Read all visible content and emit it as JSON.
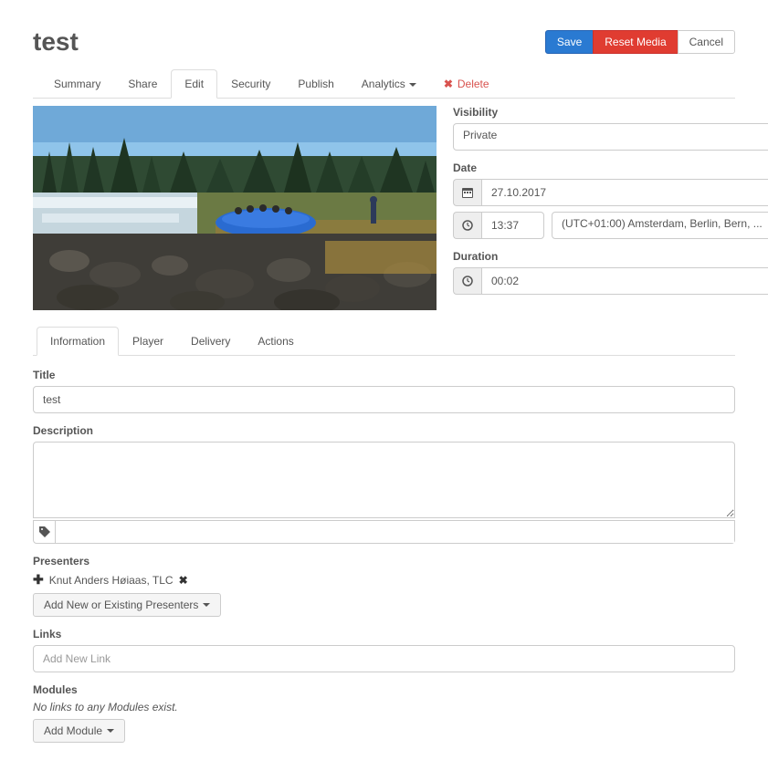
{
  "header": {
    "title": "test",
    "buttons": {
      "save": "Save",
      "reset": "Reset Media",
      "cancel": "Cancel"
    }
  },
  "nav_tabs": {
    "summary": "Summary",
    "share": "Share",
    "edit": "Edit",
    "security": "Security",
    "publish": "Publish",
    "analytics": "Analytics",
    "delete": "Delete"
  },
  "right_panel": {
    "visibility": {
      "label": "Visibility",
      "value": "Private"
    },
    "date": {
      "label": "Date",
      "value": "27.10.2017",
      "time": "13:37",
      "timezone": "(UTC+01:00) Amsterdam, Berlin, Bern, ..."
    },
    "duration": {
      "label": "Duration",
      "value": "00:02"
    }
  },
  "sub_tabs": {
    "information": "Information",
    "player": "Player",
    "delivery": "Delivery",
    "actions": "Actions"
  },
  "information": {
    "title": {
      "label": "Title",
      "value": "test"
    },
    "description": {
      "label": "Description",
      "value": ""
    },
    "tags_value": "",
    "presenters": {
      "label": "Presenters",
      "items": [
        {
          "name": "Knut Anders Høiaas, TLC"
        }
      ],
      "add_button": "Add New or Existing Presenters"
    },
    "links": {
      "label": "Links",
      "placeholder": "Add New Link"
    },
    "modules": {
      "label": "Modules",
      "empty_text": "No links to any Modules exist.",
      "add_button": "Add Module"
    }
  }
}
